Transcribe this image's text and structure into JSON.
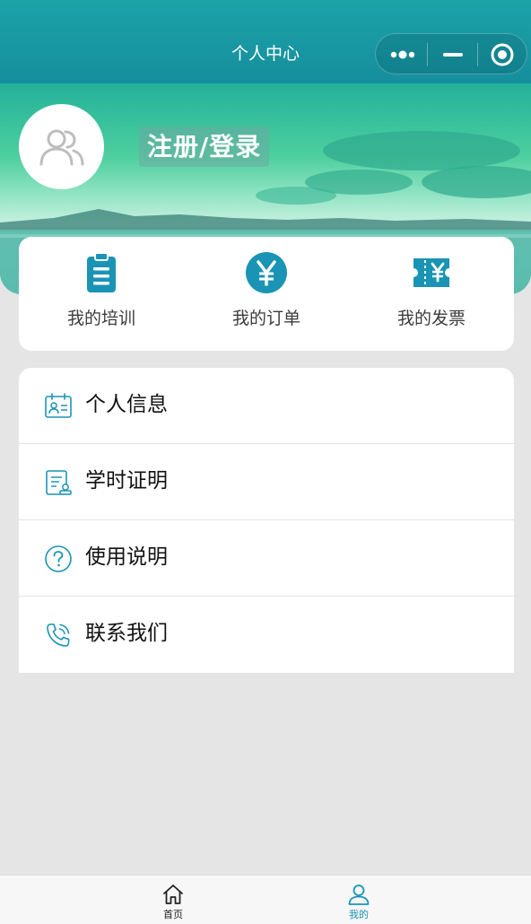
{
  "navbar": {
    "title": "个人中心",
    "capsule": {
      "more_icon": "more-dots-icon",
      "minimize_icon": "minimize-icon",
      "close_icon": "target-close-icon"
    }
  },
  "profile": {
    "avatar_icon": "users-icon",
    "login_label": "注册/登录"
  },
  "quick_links": [
    {
      "label": "我的培训",
      "icon": "clipboard-icon"
    },
    {
      "label": "我的订单",
      "icon": "yen-circle-icon"
    },
    {
      "label": "我的发票",
      "icon": "invoice-ticket-icon"
    }
  ],
  "menu": [
    {
      "label": "个人信息",
      "icon": "id-card-icon"
    },
    {
      "label": "学时证明",
      "icon": "certificate-icon"
    },
    {
      "label": "使用说明",
      "icon": "help-circle-icon"
    },
    {
      "label": "联系我们",
      "icon": "phone-icon"
    }
  ],
  "tabbar": {
    "tabs": [
      {
        "label": "首页",
        "icon": "home-icon",
        "active": false
      },
      {
        "label": "我的",
        "icon": "user-icon",
        "active": true
      }
    ]
  },
  "colors": {
    "brand": "#1a94b4",
    "header": "#168e9d",
    "tab_active": "#1a94b4"
  }
}
